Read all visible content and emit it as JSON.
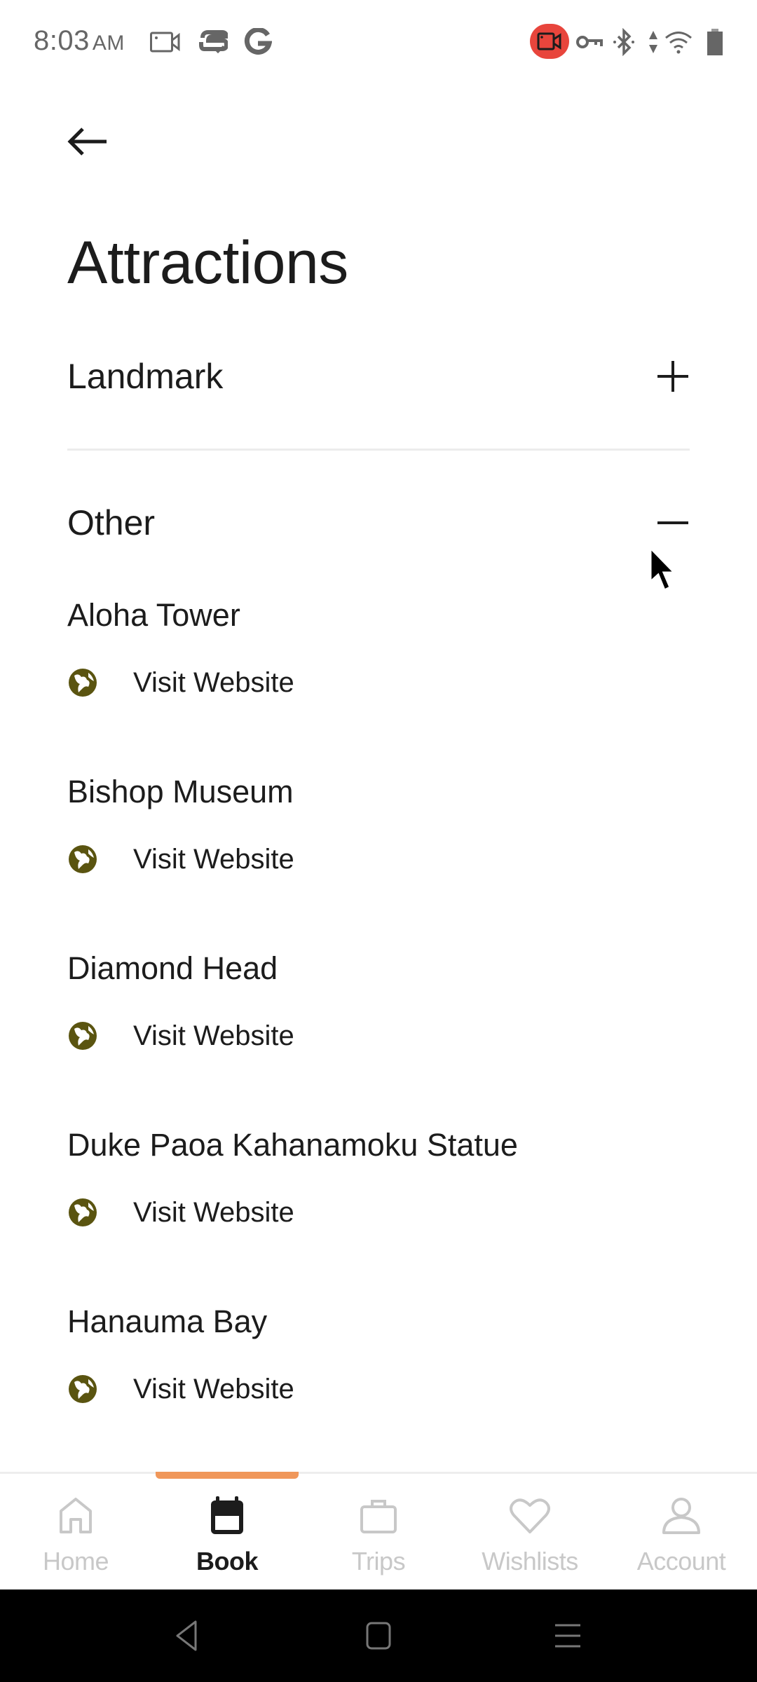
{
  "status_bar": {
    "time": "8:03",
    "ampm": "AM",
    "left_icons": [
      "screen-record-icon",
      "app-notification-icon",
      "google-icon"
    ],
    "right_icons": [
      "recording-indicator-icon",
      "vpn-key-icon",
      "bluetooth-icon",
      "data-arrows-icon",
      "wifi-icon",
      "battery-icon"
    ],
    "recording_color": "#e8453c"
  },
  "header": {
    "back_icon": "arrow-left-icon",
    "title": "Attractions"
  },
  "sections": [
    {
      "label": "Landmark",
      "expanded": false,
      "toggle_icon": "plus-icon"
    },
    {
      "label": "Other",
      "expanded": true,
      "toggle_icon": "minus-icon",
      "items": [
        {
          "name": "Aloha Tower",
          "link_label": "Visit Website",
          "link_icon": "globe-icon"
        },
        {
          "name": "Bishop Museum",
          "link_label": "Visit Website",
          "link_icon": "globe-icon"
        },
        {
          "name": "Diamond Head",
          "link_label": "Visit Website",
          "link_icon": "globe-icon"
        },
        {
          "name": "Duke Paoa Kahanamoku Statue",
          "link_label": "Visit Website",
          "link_icon": "globe-icon"
        },
        {
          "name": "Hanauma Bay",
          "link_label": "Visit Website",
          "link_icon": "globe-icon"
        }
      ]
    }
  ],
  "colors": {
    "accent": "#f0975a",
    "globe": "#5a5410",
    "text": "#1c1c1c",
    "nav_inactive": "#c8c8c8"
  },
  "bottom_nav": {
    "active": "Book",
    "items": [
      {
        "label": "Home",
        "icon": "home-icon"
      },
      {
        "label": "Book",
        "icon": "calendar-icon"
      },
      {
        "label": "Trips",
        "icon": "suitcase-icon"
      },
      {
        "label": "Wishlists",
        "icon": "heart-icon"
      },
      {
        "label": "Account",
        "icon": "person-icon"
      }
    ]
  },
  "system_nav": [
    "back-icon",
    "home-square-icon",
    "recents-icon"
  ]
}
